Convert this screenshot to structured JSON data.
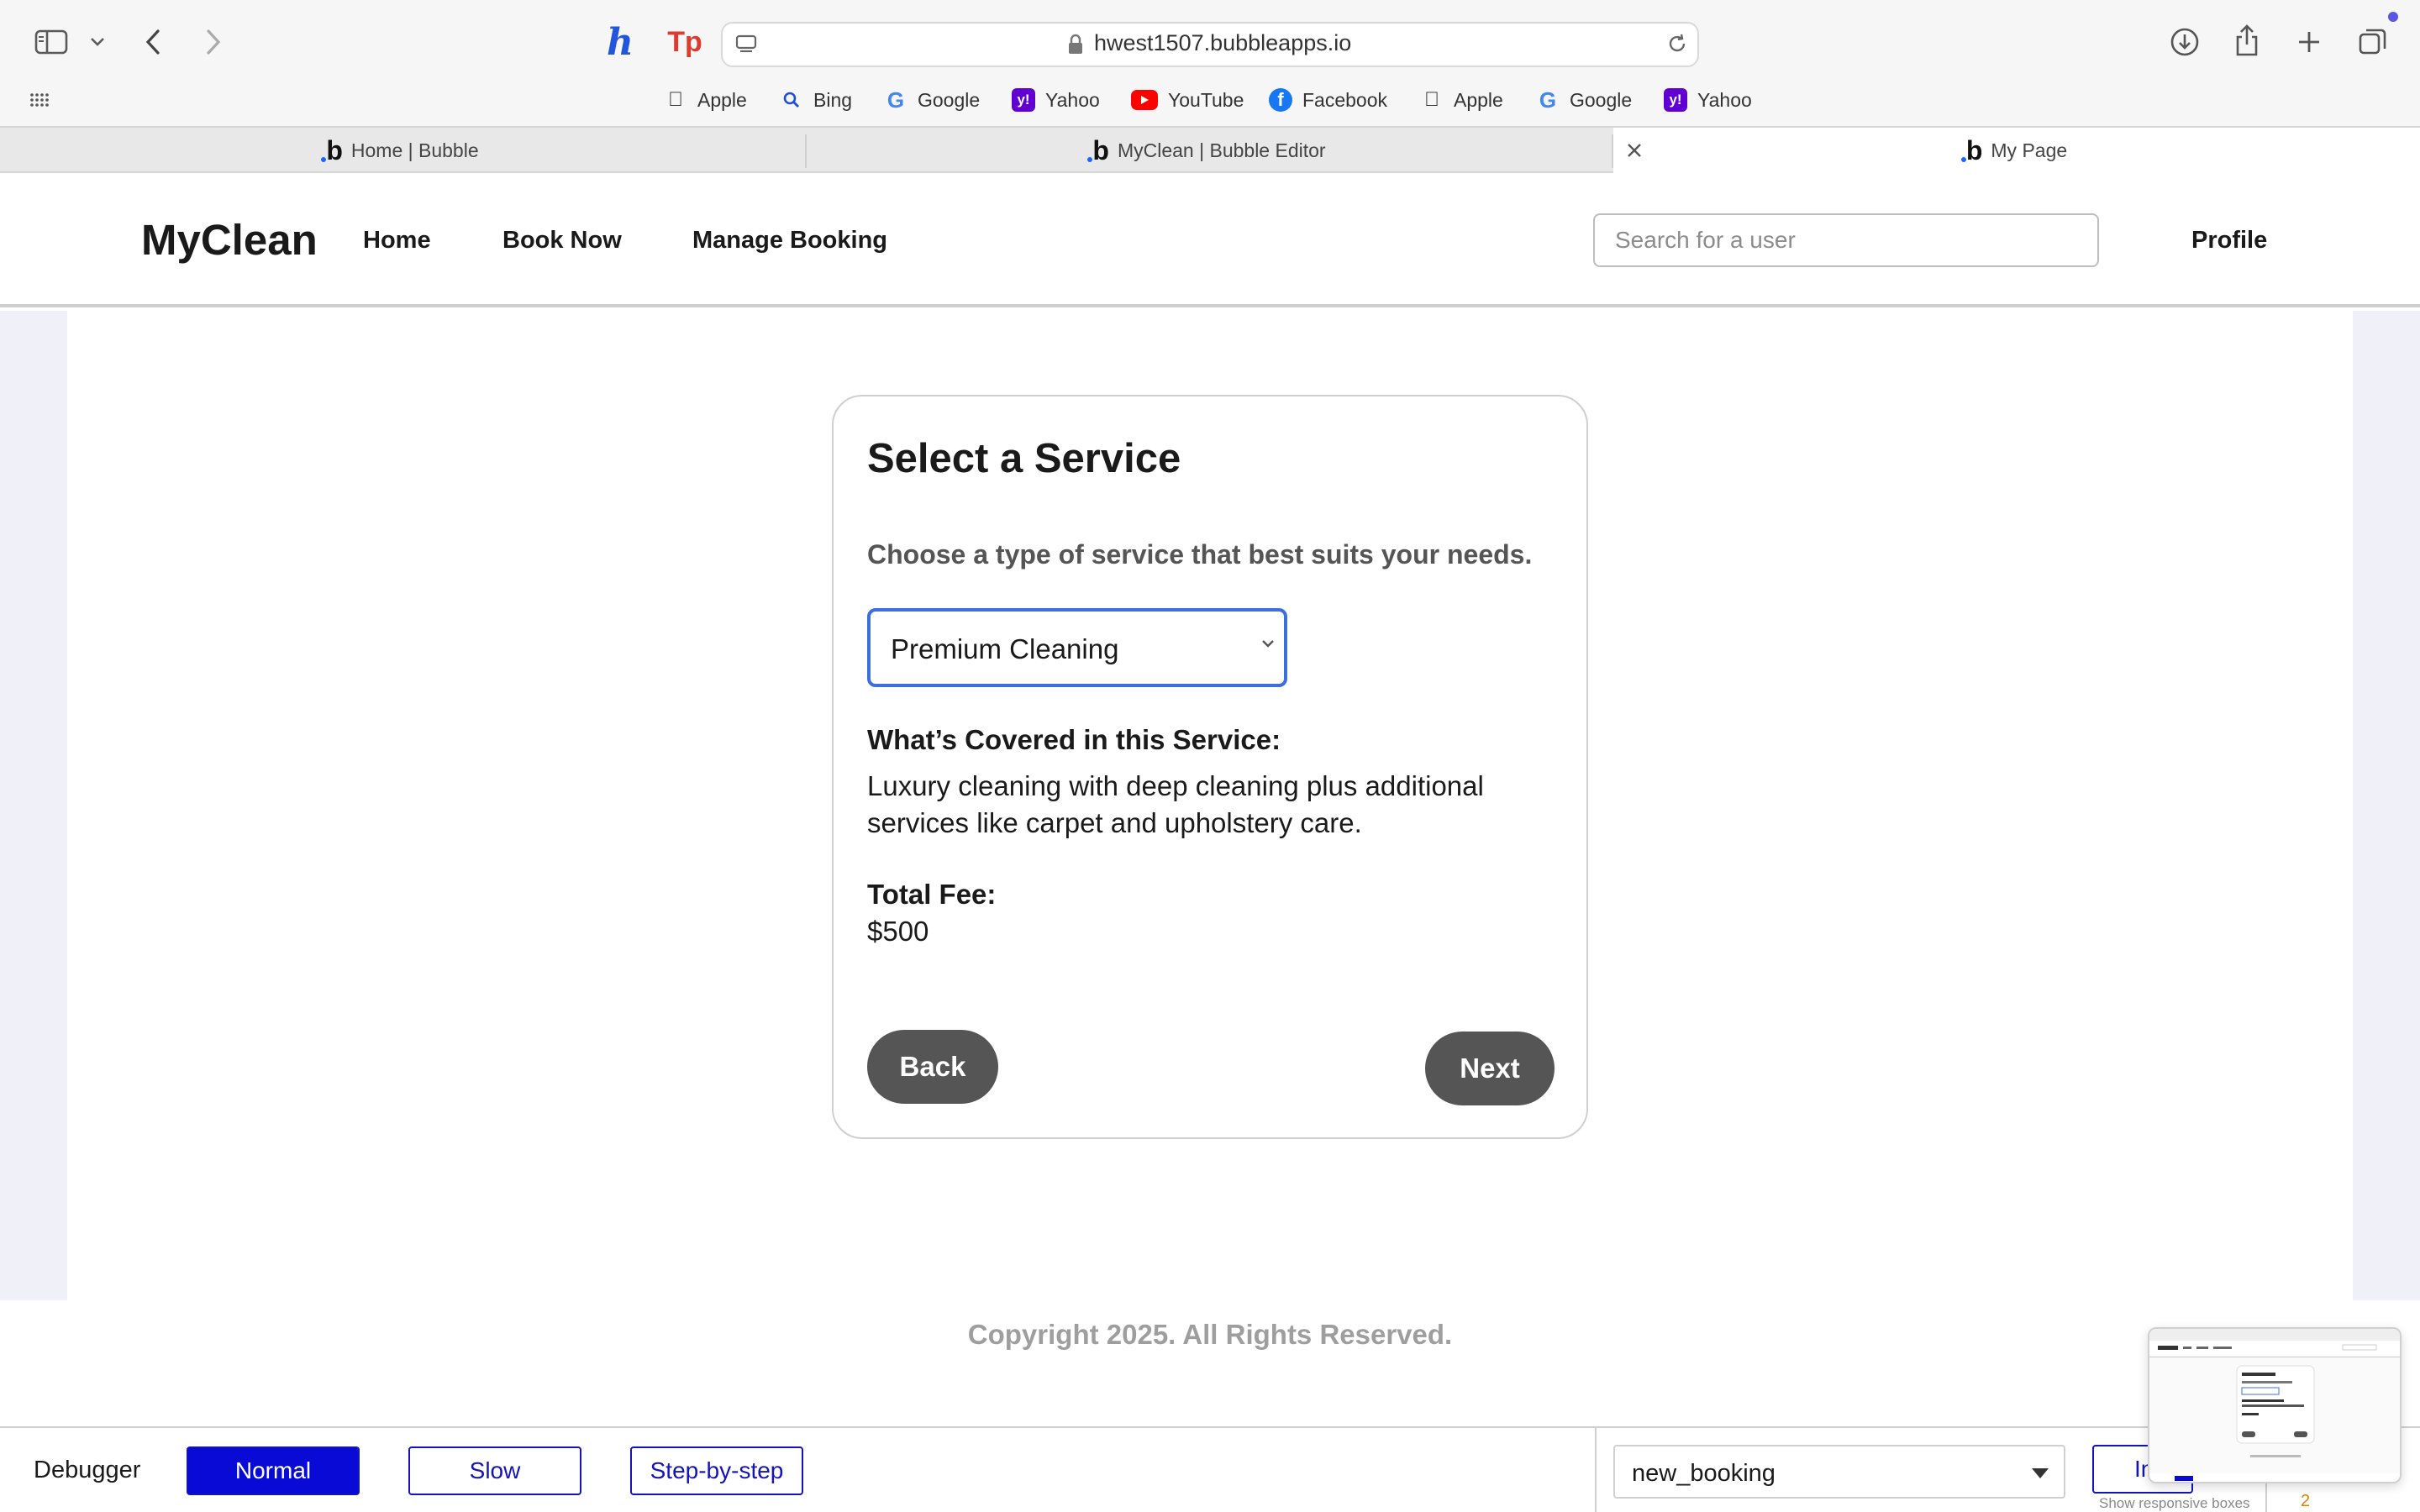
{
  "browser": {
    "url": "hwest1507.bubbleapps.io",
    "toolbar_icons": [
      "sidebar-icon",
      "chevron-down-icon",
      "back-icon",
      "forward-icon",
      "download-icon",
      "share-icon",
      "new-tab-icon",
      "tabs-overview-icon"
    ],
    "extensions": [
      {
        "label": "h",
        "color": "#2255dd"
      },
      {
        "label": "Tp",
        "color": "#e03a2f"
      }
    ],
    "bookmarks": [
      {
        "label": "Apple",
        "icon": "apple-icon"
      },
      {
        "label": "Bing",
        "icon": "search-icon"
      },
      {
        "label": "Google",
        "icon": "google-icon"
      },
      {
        "label": "Yahoo",
        "icon": "yahoo-icon"
      },
      {
        "label": "YouTube",
        "icon": "youtube-icon"
      },
      {
        "label": "Facebook",
        "icon": "facebook-icon"
      },
      {
        "label": "Apple",
        "icon": "apple-icon"
      },
      {
        "label": "Google",
        "icon": "google-icon"
      },
      {
        "label": "Yahoo",
        "icon": "yahoo-icon"
      }
    ],
    "tabs": [
      {
        "label": "Home | Bubble",
        "active": false
      },
      {
        "label": "MyClean | Bubble Editor",
        "active": false
      },
      {
        "label": "My Page",
        "active": true
      }
    ]
  },
  "app": {
    "brand": "MyClean",
    "nav": [
      "Home",
      "Book Now",
      "Manage Booking"
    ],
    "search_placeholder": "Search for a user",
    "profile": "Profile"
  },
  "card": {
    "title": "Select a Service",
    "subtitle": "Choose a type of service that best suits your needs.",
    "selected_service": "Premium Cleaning",
    "covered_title": "What’s Covered in this Service:",
    "covered_desc": "Luxury cleaning with deep cleaning plus additional services like carpet and upholstery care.",
    "fee_title": "Total Fee:",
    "fee_value": "$500",
    "back_label": "Back",
    "next_label": "Next"
  },
  "footer": {
    "copyright": "Copyright 2025. All Rights Reserved."
  },
  "debugger": {
    "label": "Debugger",
    "modes": [
      "Normal",
      "Slow",
      "Step-by-step"
    ],
    "active_mode": "Normal",
    "workflow_select": "new_booking",
    "inspect_label": "Inspect",
    "responsive_label": "Show responsive boxes",
    "count": "2"
  },
  "colors": {
    "accent": "#3b6fdf",
    "button_dark": "#555555",
    "debugger_blue": "#0a0ad6",
    "page_side_bg": "#f0f0f8"
  }
}
